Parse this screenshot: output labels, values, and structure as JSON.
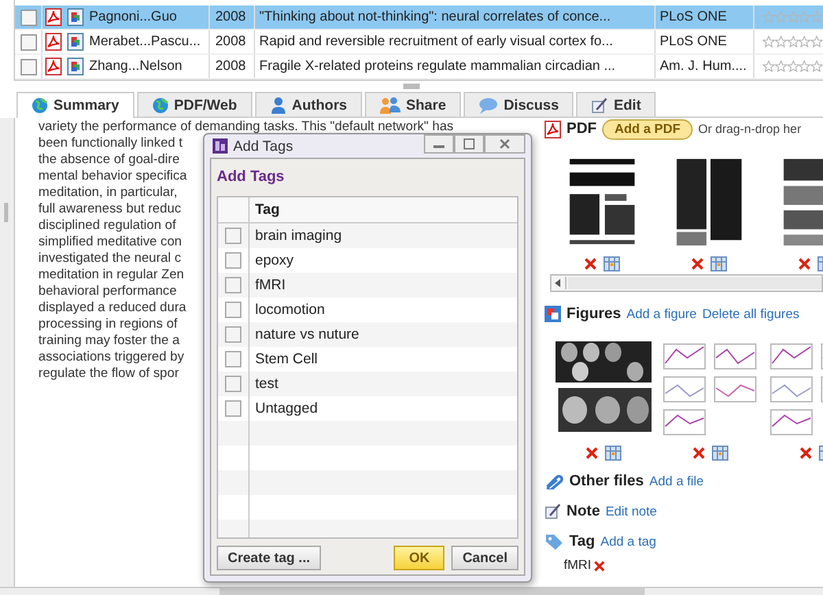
{
  "papers": [
    {
      "checked": false,
      "selected": true,
      "authors": "Pagnoni...Guo",
      "year": "2008",
      "title": "\"Thinking about not-thinking\": neural correlates of conce...",
      "journal": "PLoS ONE",
      "stars": 0
    },
    {
      "checked": false,
      "selected": false,
      "authors": "Merabet...Pascu...",
      "year": "2008",
      "title": "Rapid and reversible recruitment of early visual cortex fo...",
      "journal": "PLoS ONE",
      "stars": 0
    },
    {
      "checked": false,
      "selected": false,
      "authors": "Zhang...Nelson",
      "year": "2008",
      "title": "Fragile X-related proteins regulate mammalian circadian ...",
      "journal": "Am. J. Hum....",
      "stars": 0
    }
  ],
  "tabs": [
    {
      "label": "Summary",
      "selected": true
    },
    {
      "label": "PDF/Web",
      "selected": false
    },
    {
      "label": "Authors",
      "selected": false
    },
    {
      "label": "Share",
      "selected": false
    },
    {
      "label": "Discuss",
      "selected": false
    },
    {
      "label": "Edit",
      "selected": false
    }
  ],
  "abstract_lines": [
    "variety the performance of demanding tasks. This \"default network\" has",
    "been functionally linked t",
    "the absence of goal-dire",
    "mental behavior specifica",
    "meditation, in particular,",
    "full awareness but reduc",
    "disciplined regulation of",
    "simplified meditative con",
    "investigated the neural c",
    "meditation in regular Zen",
    "behavioral performance",
    "displayed a reduced dura",
    "processing in regions of",
    "training may foster the a",
    "associations triggered by",
    "regulate the flow of spor"
  ],
  "pdf": {
    "label": "PDF",
    "button": "Add a PDF",
    "hint": "Or drag-n-drop her"
  },
  "figures": {
    "label": "Figures",
    "add": "Add a figure",
    "delete_all": "Delete all figures"
  },
  "other_files": {
    "label": "Other files",
    "action": "Add a file"
  },
  "note": {
    "label": "Note",
    "action": "Edit note"
  },
  "tag": {
    "label": "Tag",
    "action": "Add a tag",
    "tags": [
      "fMRI"
    ]
  },
  "dialog": {
    "title": "Add Tags",
    "heading": "Add Tags",
    "column": "Tag",
    "tags": [
      {
        "name": "brain imaging",
        "checked": false
      },
      {
        "name": "epoxy",
        "checked": false
      },
      {
        "name": "fMRI",
        "checked": false
      },
      {
        "name": "locomotion",
        "checked": false
      },
      {
        "name": "nature vs nuture",
        "checked": false
      },
      {
        "name": "Stem Cell",
        "checked": false
      },
      {
        "name": "test",
        "checked": false
      },
      {
        "name": "Untagged",
        "checked": false
      }
    ],
    "create": "Create tag ...",
    "ok": "OK",
    "cancel": "Cancel"
  }
}
